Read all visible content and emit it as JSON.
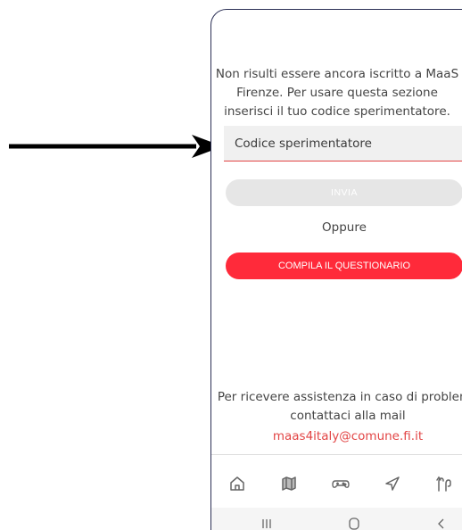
{
  "screen": {
    "message": "Non risulti essere ancora iscritto a MaaS Firenze. Per usare questa sezione inserisci il tuo codice sperimentatore.",
    "code_placeholder": "Codice sperimentatore",
    "submit_label": "INVIA",
    "or_label": "Oppure",
    "questionnaire_label": "COMPILA IL QUESTIONARIO",
    "assistance_text": "Per ricevere assistenza in caso di problemi, contattaci alla mail",
    "assistance_email": "maas4italy@comune.fi.it"
  },
  "bottom_nav": [
    {
      "icon": "home-icon"
    },
    {
      "icon": "map-icon"
    },
    {
      "icon": "gamepad-icon"
    },
    {
      "icon": "navigation-icon"
    },
    {
      "icon": "route-icon"
    }
  ],
  "system_nav": [
    "recent-apps-icon",
    "home-button-icon",
    "back-icon"
  ],
  "colors": {
    "accent": "#ff2a3a",
    "error_underline": "#e24545",
    "disabled_button": "#e6e6e6",
    "frame_border": "#2b2f55"
  }
}
